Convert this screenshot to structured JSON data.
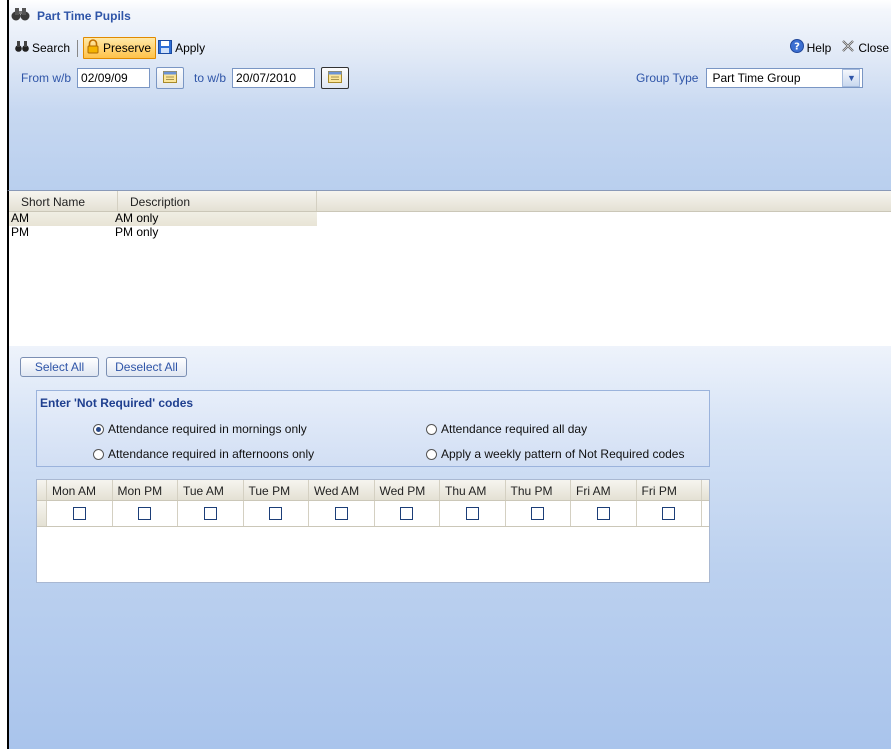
{
  "window": {
    "title": "Part Time Pupils"
  },
  "toolbar": {
    "search_label": "Search",
    "preserve_label": "Preserve",
    "apply_label": "Apply",
    "help_label": "Help",
    "close_label": "Close"
  },
  "filters": {
    "from_label": "From w/b",
    "from_value": "02/09/09",
    "to_label": "to w/b",
    "to_value": "20/07/2010",
    "group_type_label": "Group Type",
    "group_type_value": "Part Time Group"
  },
  "groups_grid": {
    "columns": [
      "Short Name",
      "Description"
    ],
    "rows": [
      {
        "short_name": "AM",
        "description": "AM only",
        "selected": true
      },
      {
        "short_name": "PM",
        "description": "PM only",
        "selected": false
      }
    ]
  },
  "selection_buttons": {
    "select_all": "Select All",
    "deselect_all": "Deselect All"
  },
  "not_required": {
    "title": "Enter 'Not Required' codes",
    "options": [
      {
        "label": "Attendance required in mornings only",
        "checked": true
      },
      {
        "label": "Attendance required all day",
        "checked": false
      },
      {
        "label": "Attendance required in afternoons only",
        "checked": false
      },
      {
        "label": "Apply a weekly pattern of Not Required codes",
        "checked": false
      }
    ]
  },
  "weekly_pattern": {
    "columns": [
      "Mon AM",
      "Mon PM",
      "Tue AM",
      "Tue PM",
      "Wed AM",
      "Wed PM",
      "Thu AM",
      "Thu PM",
      "Fri AM",
      "Fri PM"
    ],
    "checked": [
      false,
      false,
      false,
      false,
      false,
      false,
      false,
      false,
      false,
      false
    ]
  }
}
